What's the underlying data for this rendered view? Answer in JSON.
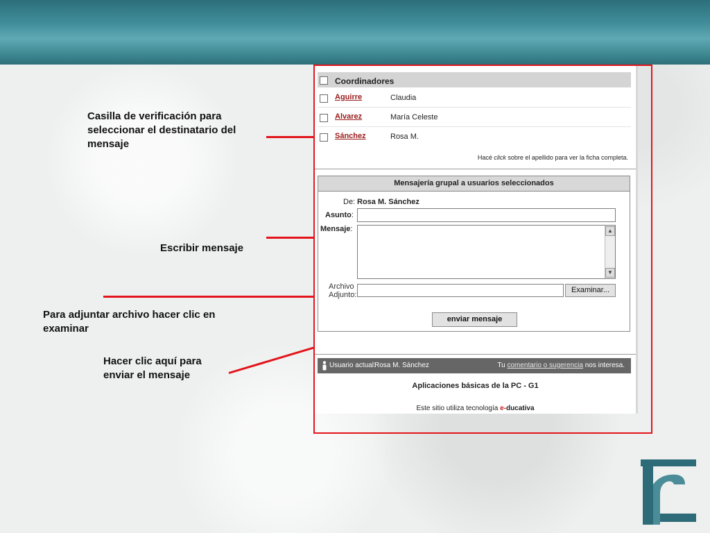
{
  "annotations": {
    "checkbox_note": "Casilla de verificación para seleccionar el destinatario del mensaje",
    "write_note": "Escribir mensaje",
    "attach_note": "Para adjuntar archivo hacer clic en examinar",
    "send_note": "Hacer clic aquí para enviar el mensaje"
  },
  "recipients": {
    "group_label": "Coordinadores",
    "rows": [
      {
        "last_name": "Aguirre",
        "first_name": "Claudia"
      },
      {
        "last_name": "Alvarez",
        "first_name": "María Celeste"
      },
      {
        "last_name": "Sánchez",
        "first_name": "Rosa M."
      }
    ],
    "hint_prefix": "Hacé ",
    "hint_em": "click",
    "hint_suffix": " sobre el apellido para ver la ficha completa."
  },
  "message_form": {
    "title": "Mensajería grupal a usuarios seleccionados",
    "from_label": "De:",
    "from_value": "Rosa M. Sánchez",
    "subject_label": "Asunto",
    "subject_value": "",
    "message_label": "Mensaje",
    "message_value": "",
    "attach_label_1": "Archivo",
    "attach_label_2": "Adjunto:",
    "attach_value": "",
    "browse_button": "Examinar...",
    "send_button": "enviar mensaje"
  },
  "status_bar": {
    "user_label": "Usuario actual:",
    "user_name": "Rosa M. Sánchez",
    "feedback_prefix": "Tu ",
    "feedback_link": "comentario o sugerencia",
    "feedback_suffix": " nos interesa."
  },
  "footer": {
    "course": "Aplicaciones básicas de la PC - G1",
    "powered_prefix": "Este sitio utiliza tecnología ",
    "brand_e": "e-",
    "brand_rest": "ducativa"
  },
  "colors": {
    "accent_red": "#e3141b",
    "header_teal": "#3f8d99",
    "link_red": "#9a1b1b"
  }
}
